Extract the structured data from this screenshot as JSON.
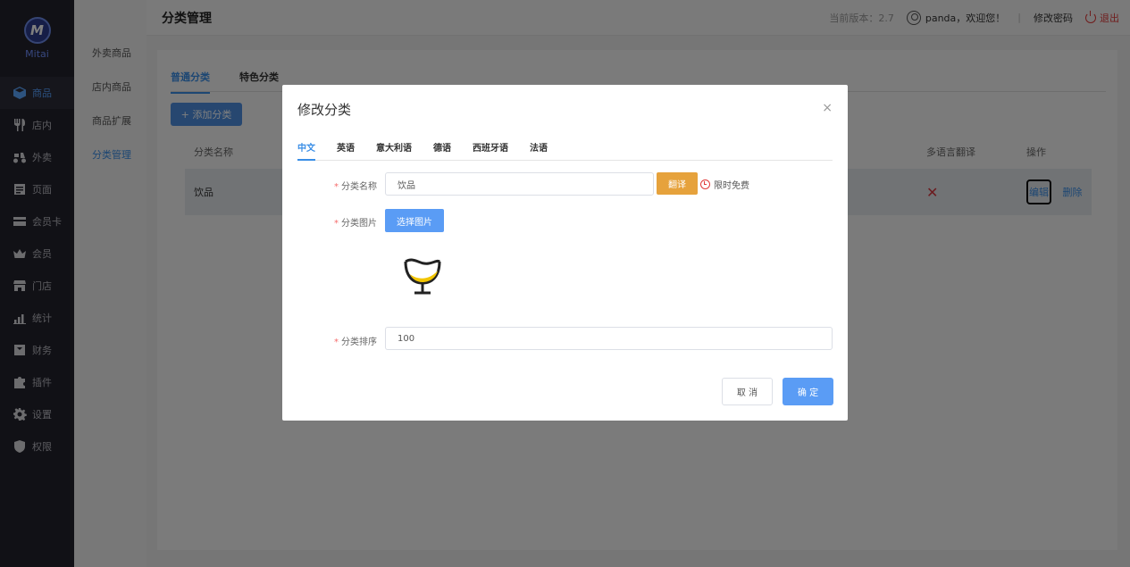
{
  "app": {
    "logo_text": "Mitai",
    "logo_mark": "M"
  },
  "sidebar": {
    "items": [
      {
        "label": "商品",
        "icon": "box-icon",
        "active": true
      },
      {
        "label": "店内",
        "icon": "cutlery-icon"
      },
      {
        "label": "外卖",
        "icon": "scooter-icon"
      },
      {
        "label": "页面",
        "icon": "page-icon"
      },
      {
        "label": "会员卡",
        "icon": "card-icon"
      },
      {
        "label": "会员",
        "icon": "crown-icon"
      },
      {
        "label": "门店",
        "icon": "store-icon"
      },
      {
        "label": "统计",
        "icon": "chart-icon"
      },
      {
        "label": "财务",
        "icon": "finance-icon"
      },
      {
        "label": "插件",
        "icon": "puzzle-icon"
      },
      {
        "label": "设置",
        "icon": "gear-icon"
      },
      {
        "label": "权限",
        "icon": "shield-icon"
      }
    ]
  },
  "subnav": {
    "items": [
      {
        "label": "外卖商品"
      },
      {
        "label": "店内商品"
      },
      {
        "label": "商品扩展"
      },
      {
        "label": "分类管理",
        "active": true
      }
    ]
  },
  "header": {
    "title": "分类管理",
    "version": "当前版本：2.7",
    "welcome": "panda，欢迎您！",
    "change_password": "修改密码",
    "logout": "退出"
  },
  "main": {
    "tabs": [
      {
        "label": "普通分类",
        "active": true
      },
      {
        "label": "特色分类"
      }
    ],
    "add_button": "+ 添加分类",
    "table": {
      "col_name": "分类名称",
      "col_multilang": "多语言翻译",
      "col_ops": "操作",
      "rows": [
        {
          "name": "饮品",
          "multilang": "✕",
          "edit": "编辑",
          "delete": "删除"
        }
      ]
    }
  },
  "modal": {
    "title": "修改分类",
    "close": "×",
    "lang_tabs": [
      {
        "label": "中文",
        "active": true
      },
      {
        "label": "英语"
      },
      {
        "label": "意大利语"
      },
      {
        "label": "德语"
      },
      {
        "label": "西班牙语"
      },
      {
        "label": "法语"
      }
    ],
    "fields": {
      "name_label": "分类名称",
      "name_value": "饮品",
      "translate_button": "翻译",
      "free_tag": "限时免费",
      "image_label": "分类图片",
      "choose_image_button": "选择图片",
      "sort_label": "分类排序",
      "sort_value": "100"
    },
    "cancel_button": "取 消",
    "ok_button": "确 定"
  },
  "colors": {
    "accent": "#3a8ee6",
    "translate": "#e6a23c",
    "danger": "#e03b3b",
    "sidebar_bg": "#23232d"
  }
}
